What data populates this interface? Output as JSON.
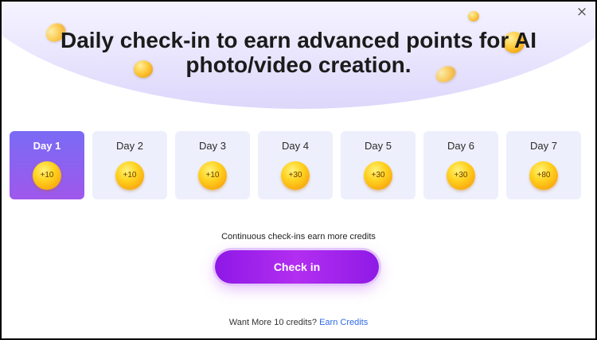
{
  "dialog": {
    "headline": "Daily check-in to earn advanced points for AI photo/video creation.",
    "close_icon": "×"
  },
  "days": [
    {
      "label": "Day 1",
      "reward": "+10",
      "active": true
    },
    {
      "label": "Day 2",
      "reward": "+10",
      "active": false
    },
    {
      "label": "Day 3",
      "reward": "+10",
      "active": false
    },
    {
      "label": "Day 4",
      "reward": "+30",
      "active": false
    },
    {
      "label": "Day 5",
      "reward": "+30",
      "active": false
    },
    {
      "label": "Day 6",
      "reward": "+30",
      "active": false
    },
    {
      "label": "Day 7",
      "reward": "+80",
      "active": false
    }
  ],
  "hint": "Continuous check-ins earn more credits",
  "checkin_button": "Check in",
  "footer": {
    "text": "Want More 10 credits?",
    "link": "Earn Credits"
  },
  "colors": {
    "accent": "#a020f0",
    "active_day": "#8a63f0",
    "link": "#2d6ae8"
  }
}
